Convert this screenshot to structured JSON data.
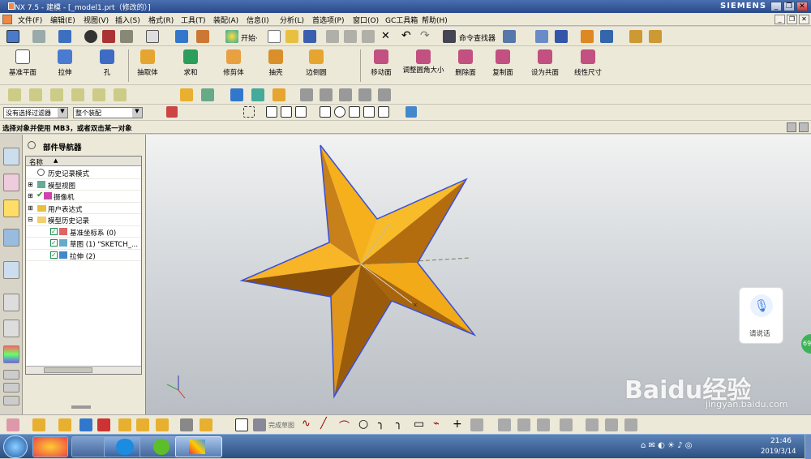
{
  "title": "NX 7.5 - 建模 - [_model1.prt（修改的）]",
  "brand": "SIEMENS",
  "menus": [
    "文件(F)",
    "编辑(E)",
    "视图(V)",
    "插入(S)",
    "格式(R)",
    "工具(T)",
    "装配(A)",
    "信息(I)",
    "分析(L)",
    "首选项(P)",
    "窗口(O)",
    "GC工具箱",
    "帮助(H)"
  ],
  "toolbar1": {
    "start_label": "开始·",
    "find_label": "命令查找器"
  },
  "toolbar2": [
    {
      "label": "基准平面"
    },
    {
      "label": "拉伸"
    },
    {
      "label": "孔"
    },
    {
      "label": "抽取体"
    },
    {
      "label": "求和"
    },
    {
      "label": "修剪体"
    },
    {
      "label": "抽壳"
    },
    {
      "label": "边倒圆"
    },
    {
      "label": "移动面"
    },
    {
      "label": "调整圆角大小"
    },
    {
      "label": "删除面"
    },
    {
      "label": "复制面"
    },
    {
      "label": "设为共面"
    },
    {
      "label": "线性尺寸"
    }
  ],
  "filter": {
    "type_filter": "没有选择过滤器",
    "scope": "整个装配"
  },
  "hint": "选择对象并使用 MB3，或者双击某一对象",
  "navigator": {
    "title": "部件导航器",
    "column": "名称",
    "rows": [
      {
        "label": "历史记录模式"
      },
      {
        "label": "模型视图"
      },
      {
        "label": "摄像机"
      },
      {
        "label": "用户表达式"
      },
      {
        "label": "模型历史记录"
      },
      {
        "label": "基准坐标系 (0)"
      },
      {
        "label": "草图 (1) \"SKETCH_..."
      },
      {
        "label": "拉伸 (2)"
      }
    ]
  },
  "voice_button": "请说话",
  "badge": "69",
  "bottom_toolbar": {
    "finish_sketch": "完成草图"
  },
  "watermark": {
    "brand": "Baidu经验",
    "url": "jingyan.baidu.com"
  },
  "taskbar": {
    "time": "21:46",
    "date": "2019/3/14"
  },
  "colors": {
    "star_light": "#f5b01c",
    "star_dark": "#a8650b",
    "edge": "#3a4fd8",
    "title_bar": "#2a4a8a"
  }
}
